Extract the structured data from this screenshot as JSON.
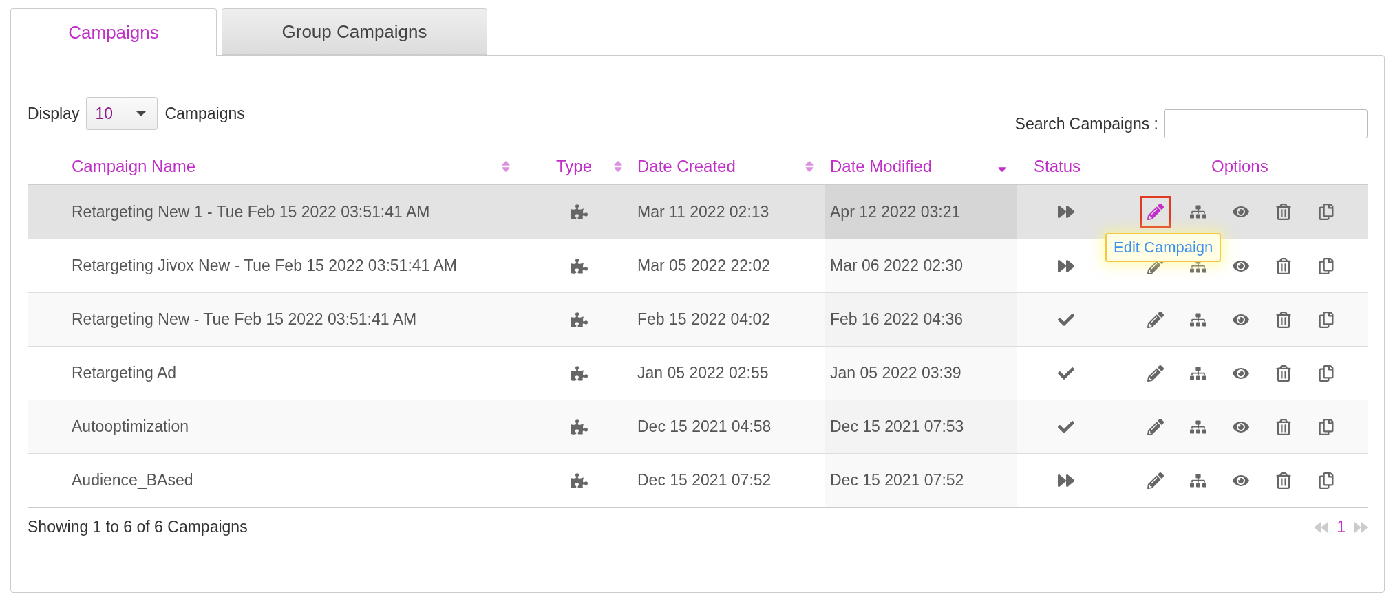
{
  "tabs": [
    {
      "label": "Campaigns",
      "selected": true
    },
    {
      "label": "Group Campaigns",
      "selected": false
    }
  ],
  "display": {
    "prefix": "Display",
    "value": "10",
    "suffix": "Campaigns"
  },
  "search": {
    "label": "Search Campaigns :"
  },
  "table": {
    "columns": [
      {
        "label": "Campaign Name",
        "sortable": true,
        "sorted": false
      },
      {
        "label": "Type",
        "sortable": true,
        "sorted": false
      },
      {
        "label": "Date Created",
        "sortable": true,
        "sorted": false
      },
      {
        "label": "Date Modified",
        "sortable": true,
        "sorted": true
      },
      {
        "label": "Status"
      },
      {
        "label": "Options"
      }
    ],
    "rows": [
      {
        "name": "Retargeting New 1 - Tue Feb 15 2022 03:51:41 AM",
        "created": "Mar 11 2022 02:13",
        "modified": "Apr 12 2022 03:21",
        "completed": false,
        "hovered": true,
        "tooltip": "Edit Campaign"
      },
      {
        "name": "Retargeting Jivox New - Tue Feb 15 2022 03:51:41 AM",
        "created": "Mar 05 2022 22:02",
        "modified": "Mar 06 2022 02:30",
        "completed": false,
        "hovered": false
      },
      {
        "name": "Retargeting New - Tue Feb 15 2022 03:51:41 AM",
        "created": "Feb 15 2022 04:02",
        "modified": "Feb 16 2022 04:36",
        "completed": true,
        "hovered": false
      },
      {
        "name": "Retargeting Ad",
        "created": "Jan 05 2022 02:55",
        "modified": "Jan 05 2022 03:39",
        "completed": true,
        "hovered": false
      },
      {
        "name": "Autooptimization",
        "created": "Dec 15 2021 04:58",
        "modified": "Dec 15 2021 07:53",
        "completed": true,
        "hovered": false
      },
      {
        "name": "Audience_BAsed",
        "created": "Dec 15 2021 07:52",
        "modified": "Dec 15 2021 07:52",
        "completed": false,
        "hovered": false
      }
    ]
  },
  "footer": {
    "summary": "Showing 1 to 6 of 6 Campaigns",
    "pages": [
      {
        "label": "1",
        "selected": true
      }
    ]
  }
}
